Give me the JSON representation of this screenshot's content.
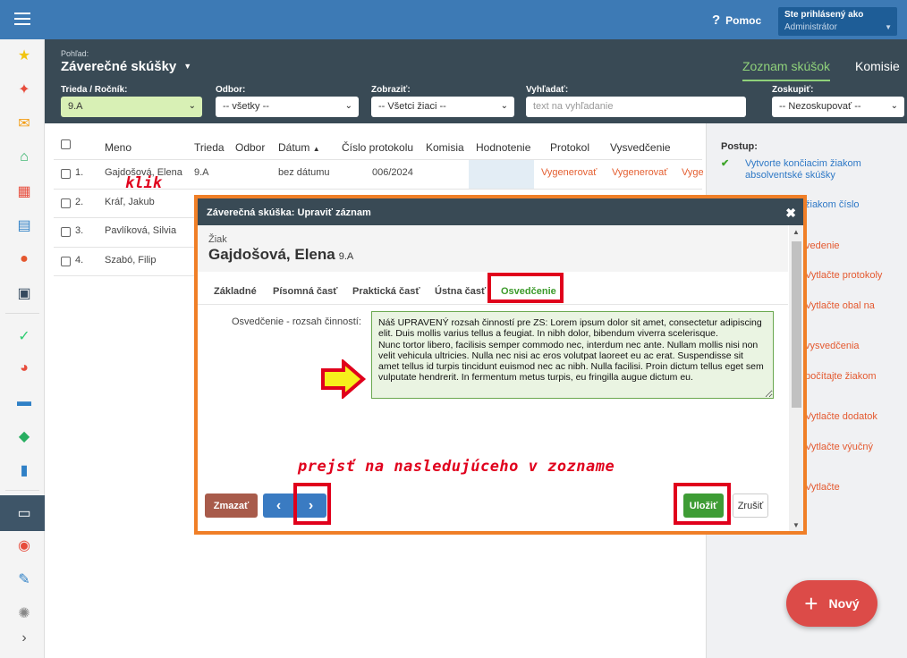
{
  "topbar": {
    "help": "Pomoc",
    "user_line1": "Ste prihlásený ako",
    "user_line2": "Administrátor"
  },
  "header": {
    "view_label": "Pohľad:",
    "view_title": "Záverečné skúšky",
    "tabs": [
      "Zoznam skúšok",
      "Komisie"
    ]
  },
  "filters": {
    "class": {
      "label": "Trieda / Ročník:",
      "value": "9.A"
    },
    "field": {
      "label": "Odbor:",
      "value": "-- všetky --"
    },
    "show": {
      "label": "Zobraziť:",
      "value": "-- Všetci žiaci --"
    },
    "search": {
      "label": "Vyhľadať:",
      "placeholder": "text na vyhľadanie"
    },
    "group": {
      "label": "Zoskupiť:",
      "value": "-- Nezoskupovať --"
    }
  },
  "table": {
    "headers": [
      "Meno",
      "Trieda",
      "Odbor",
      "Dátum",
      "Číslo protokolu",
      "Komisia",
      "Hodnotenie",
      "Protokol",
      "Vysvedčenie"
    ],
    "rows": [
      {
        "num": "1.",
        "name": "Gajdošová, Elena",
        "class": "9.A",
        "date": "bez dátumu",
        "protocol_no": "006/2024",
        "protocol": "Vygenerovať",
        "certificate": "Vygenerovať",
        "extra": "Vyge"
      },
      {
        "num": "2.",
        "name": "Kráľ, Jakub"
      },
      {
        "num": "3.",
        "name": "Pavlíková, Silvia"
      },
      {
        "num": "4.",
        "name": "Szabó, Filip"
      }
    ]
  },
  "panel": {
    "heading": "Postup:",
    "steps": [
      "Vytvorte končiacim žiakom absolventské skúšky",
      "žiakom číslo",
      "vedenie",
      "Vytlačte protokoly",
      "Vytlačte obal na",
      "vysvedčenia",
      "počítajte žiakom",
      "Vytlačte dodatok",
      "Vytlačte výučný",
      "Vytlačte"
    ]
  },
  "fab": {
    "label": "Nový"
  },
  "modal": {
    "title": "Záverečná skúška: Upraviť záznam",
    "student_label": "Žiak",
    "student_name": "Gajdošová, Elena",
    "student_class": "9.A",
    "tabs": [
      "Základné",
      "Písomná časť",
      "Praktická časť",
      "Ústna časť",
      "Osvedčenie"
    ],
    "field_label": "Osvedčenie - rozsah činností:",
    "field_value": "Náš UPRAVENÝ rozsah činností pre ZS: Lorem ipsum dolor sit amet, consectetur adipiscing elit. Duis mollis varius tellus a feugiat. In nibh dolor, bibendum viverra scelerisque.\nNunc tortor libero, facilisis semper commodo nec, interdum nec ante. Nullam mollis nisi non velit vehicula ultricies. Nulla nec nisi ac eros volutpat laoreet eu ac erat. Suspendisse sit amet tellus id turpis tincidunt euismod nec ac nibh. Nulla facilisi. Proin dictum tellus eget sem vulputate hendrerit. In fermentum metus turpis, eu fringilla augue dictum eu.",
    "delete": "Zmazať",
    "prev": "‹",
    "next": "›",
    "save": "Uložiť",
    "cancel": "Zrušiť"
  },
  "annotations": {
    "click": "klik",
    "next_hint": "prejsť na nasledujúceho v zozname"
  },
  "colors": {
    "topbar": "#3d7ab5",
    "header": "#394a55",
    "accent_green": "#3e9c35",
    "annotation_red": "#e0001c",
    "modal_border": "#f07f27"
  }
}
